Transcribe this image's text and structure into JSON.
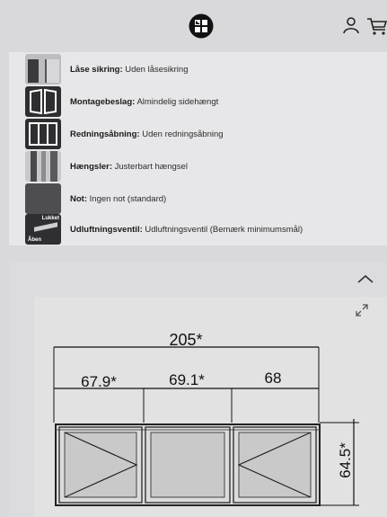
{
  "header": {
    "logo_icon": "window-logo-icon",
    "user_icon": "user-icon",
    "cart_icon": "cart-icon"
  },
  "specs": [
    {
      "label": "Låse sikring:",
      "value": "Uden låsesikring",
      "icon": "lock-thumb"
    },
    {
      "label": "Montagebeslag:",
      "value": "Almindelig sidehængt",
      "icon": "hinge-mount-thumb"
    },
    {
      "label": "Redningsåbning:",
      "value": "Uden redningsåbning",
      "icon": "rescue-opening-thumb"
    },
    {
      "label": "Hængsler:",
      "value": "Justerbart hængsel",
      "icon": "hinge-thumb"
    },
    {
      "label": "Not:",
      "value": "Ingen not (standard)",
      "icon": "groove-thumb"
    },
    {
      "label": "Udluftningsventil:",
      "value": "Udluftningsventil (Bemærk minimumsmål)",
      "icon": "vent-thumb"
    }
  ],
  "thumb_texts": {
    "lukket": "Lukket",
    "aaben": "Åben"
  },
  "drawing": {
    "total_width": "205*",
    "section_widths": [
      "67.9*",
      "69.1*",
      "68"
    ],
    "height": "64.5*"
  }
}
